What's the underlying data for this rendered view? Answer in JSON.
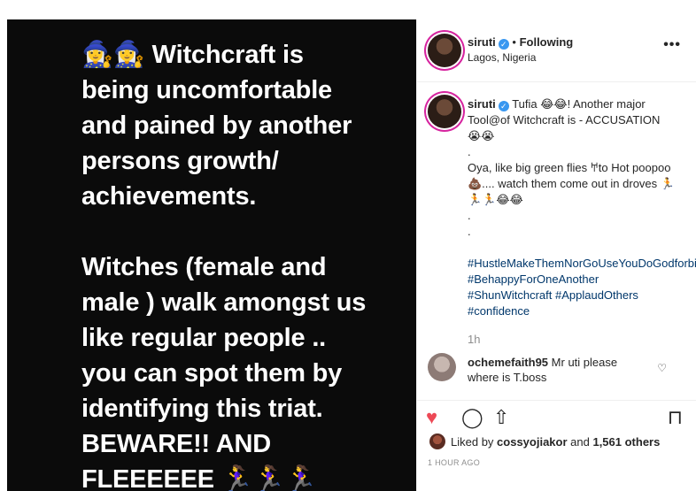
{
  "post": {
    "image_text": "🧙‍♀️🧙‍♀️ Witchcraft is\nbeing uncomfortable\nand pained by another\npersons growth/\nachievements.\n\nWitches (female and\nmale ) walk amongst us\nlike regular people ..\nyou can spot them by\nidentifying this triat.\nBEWARE!! AND\nFLEEEEEE 🏃‍♀️🏃‍♀️🏃‍♀️"
  },
  "header": {
    "username": "siruti",
    "separator": " • ",
    "follow_status": "Following",
    "location": "Lagos, Nigeria",
    "more": "•••"
  },
  "caption": {
    "username": "siruti",
    "text": "Tufia 😂😂! Another major Tool@of Witchcraft is - ACCUSATION 😭😭\n.\nOya, like big green flies 𐀀to Hot poopoo 💩.... watch them come out in droves 🏃🏃🏃😂😂\n.\n.",
    "hashtags": "#HustleMakeThemNorGoUseYouDoGodforbid #BehappyForOneAnother #ShunWitchcraft #ApplaudOthers #confidence",
    "time": "1h"
  },
  "comment": {
    "username": "ochemefaith95",
    "text": "Mr uti please where is T.boss"
  },
  "actions": {
    "like_icon": "♥",
    "comment_icon": "◯",
    "share_icon": "⇧",
    "save_icon": "⊓"
  },
  "likes": {
    "prefix": "Liked by ",
    "user": "cossyojiakor",
    "middle": " and ",
    "count": "1,561 others"
  },
  "timestamp": "1 HOUR AGO",
  "colors": {
    "like": "#ed4956",
    "verified": "#3897f0",
    "hashtag": "#00376b"
  }
}
